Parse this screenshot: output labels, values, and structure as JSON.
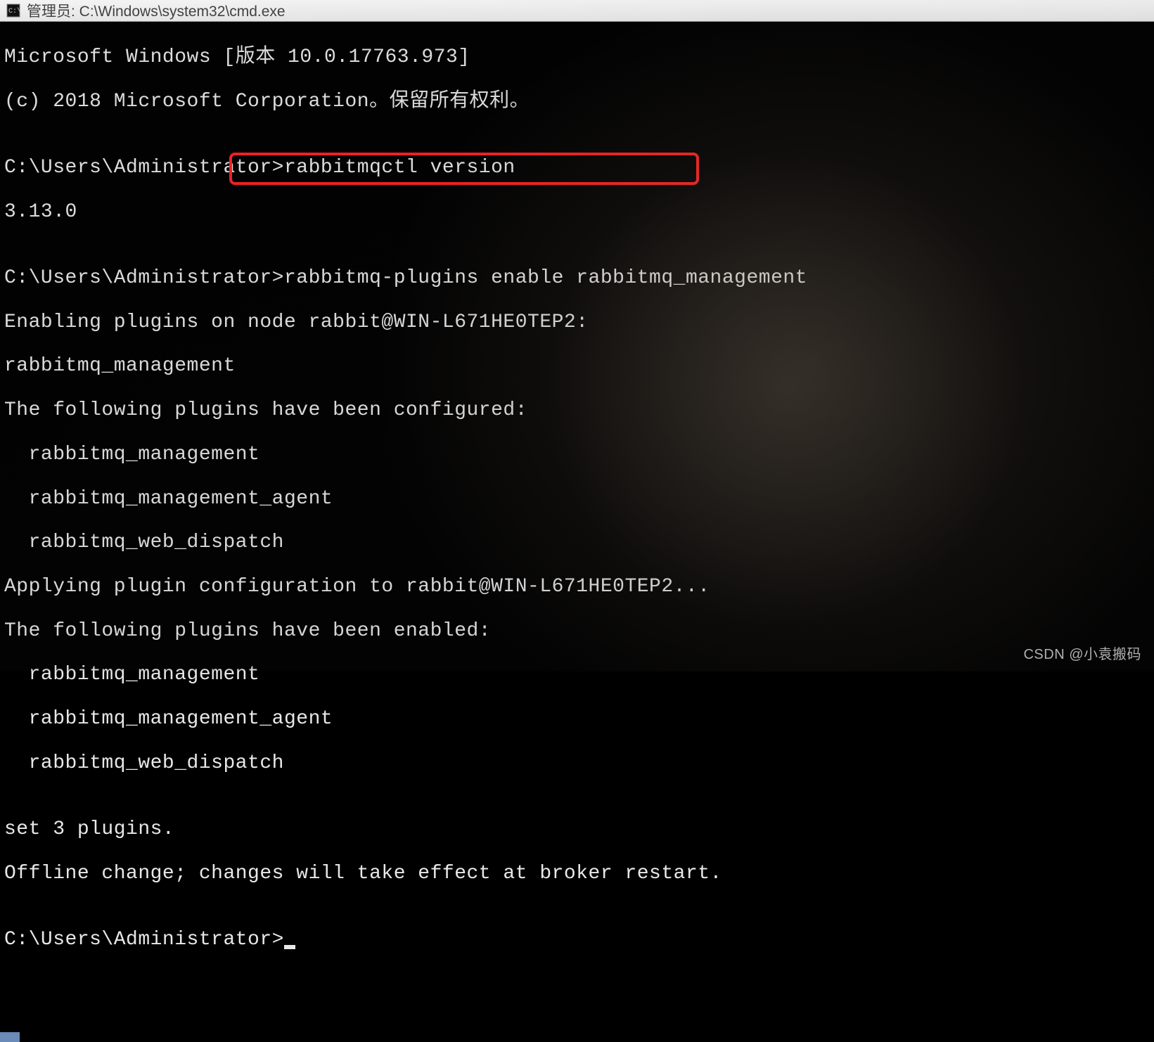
{
  "titlebar": {
    "icon_name": "cmd-icon",
    "title": "管理员: C:\\Windows\\system32\\cmd.exe"
  },
  "terminal": {
    "lines": [
      "Microsoft Windows [版本 10.0.17763.973]",
      "(c) 2018 Microsoft Corporation。保留所有权利。",
      "",
      "C:\\Users\\Administrator>rabbitmqctl version",
      "3.13.0",
      "",
      "C:\\Users\\Administrator>rabbitmq-plugins enable rabbitmq_management",
      "Enabling plugins on node rabbit@WIN-L671HE0TEP2:",
      "rabbitmq_management",
      "The following plugins have been configured:",
      "  rabbitmq_management",
      "  rabbitmq_management_agent",
      "  rabbitmq_web_dispatch",
      "Applying plugin configuration to rabbit@WIN-L671HE0TEP2...",
      "The following plugins have been enabled:",
      "  rabbitmq_management",
      "  rabbitmq_management_agent",
      "  rabbitmq_web_dispatch",
      "",
      "set 3 plugins.",
      "Offline change; changes will take effect at broker restart.",
      "",
      "C:\\Users\\Administrator>"
    ],
    "highlighted_command": "rabbitmq-plugins enable rabbitmq_management"
  },
  "watermark": "CSDN @小袁搬码"
}
